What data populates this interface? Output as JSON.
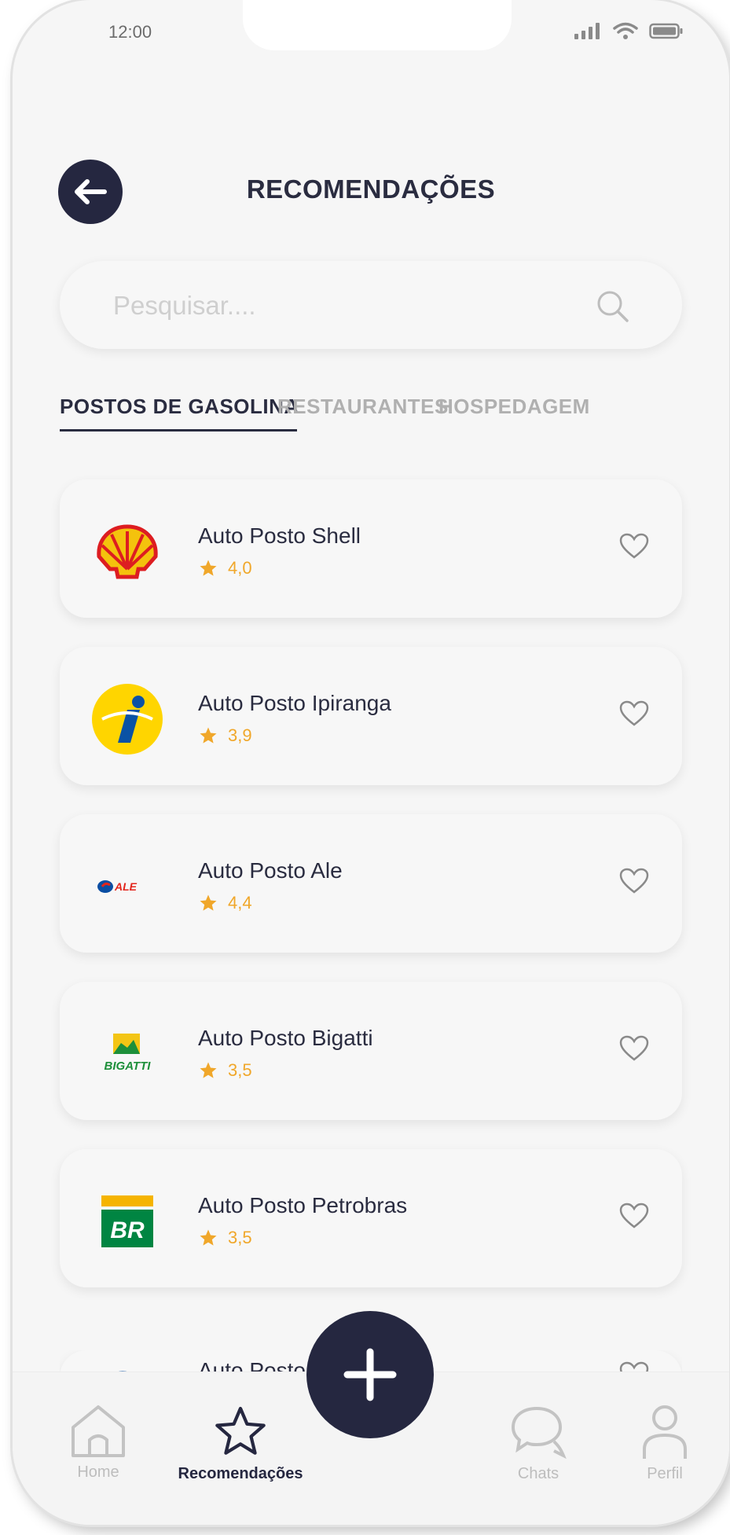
{
  "status_bar": {
    "time": "12:00"
  },
  "header": {
    "title": "RECOMENDAÇÕES"
  },
  "search": {
    "placeholder": "Pesquisar...."
  },
  "tabs": [
    {
      "label": "POSTOS DE GASOLINA",
      "active": true
    },
    {
      "label": "RESTAURANTES",
      "active": false
    },
    {
      "label": "HOSPEDAGEM",
      "active": false
    }
  ],
  "stations": [
    {
      "name": "Auto Posto Shell",
      "rating": "4,0",
      "logo": "shell-logo"
    },
    {
      "name": "Auto Posto Ipiranga",
      "rating": "3,9",
      "logo": "ipiranga-logo"
    },
    {
      "name": "Auto Posto Ale",
      "rating": "4,4",
      "logo": "ale-logo"
    },
    {
      "name": "Auto Posto Bigatti",
      "rating": "3,5",
      "logo": "bigatti-logo"
    },
    {
      "name": "Auto Posto Petrobras",
      "rating": "3,5",
      "logo": "petrobras-logo"
    }
  ],
  "partial_item": {
    "name": "Auto Posto"
  },
  "bottom_nav": [
    {
      "label": "Home",
      "icon": "home-icon",
      "active": false
    },
    {
      "label": "Recomendações",
      "icon": "star-icon",
      "active": true
    },
    {
      "label": "Chats",
      "icon": "chat-icon",
      "active": false
    },
    {
      "label": "Perfil",
      "icon": "profile-icon",
      "active": false
    }
  ],
  "colors": {
    "dark": "#252740",
    "accent_star": "#f0a72a",
    "inactive": "#b0b0b0"
  }
}
